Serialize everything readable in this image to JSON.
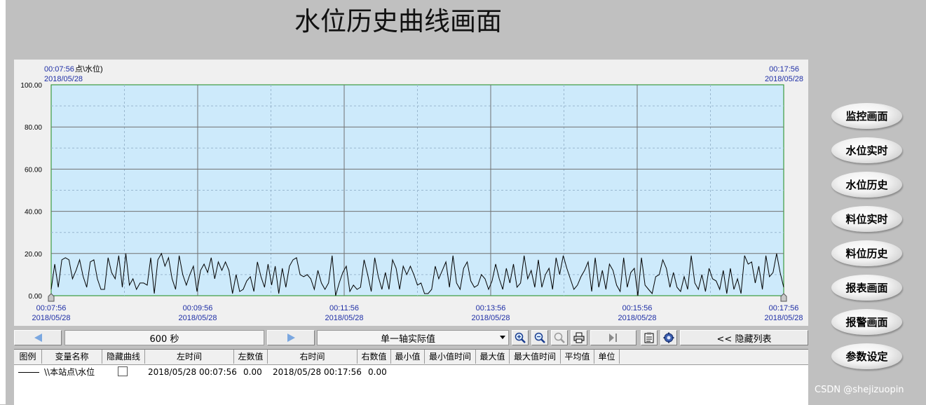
{
  "page": {
    "title": "水位历史曲线画面"
  },
  "chart_header": {
    "left_time": "00:07:56",
    "left_label": "点\\水位)",
    "left_date": "2018/05/28",
    "right_time": "00:17:56",
    "right_date": "2018/05/28"
  },
  "chart_data": {
    "type": "line",
    "ylim": [
      0,
      100
    ],
    "y_ticks": [
      "100.00",
      "80.00",
      "60.00",
      "40.00",
      "20.00",
      "0.00"
    ],
    "x_ticks": [
      {
        "time": "00:07:56",
        "date": "2018/05/28"
      },
      {
        "time": "00:09:56",
        "date": "2018/05/28"
      },
      {
        "time": "00:11:56",
        "date": "2018/05/28"
      },
      {
        "time": "00:13:56",
        "date": "2018/05/28"
      },
      {
        "time": "00:15:56",
        "date": "2018/05/28"
      },
      {
        "time": "00:17:56",
        "date": "2018/05/28"
      }
    ],
    "x_range_seconds": 600,
    "grid": true,
    "series": [
      {
        "values": [
          3,
          15,
          4,
          17,
          18,
          17,
          8,
          12,
          17,
          9,
          4,
          16,
          17,
          8,
          3,
          3,
          18,
          11,
          8,
          19,
          4,
          20,
          5,
          8,
          3,
          6,
          6,
          5,
          18,
          1,
          17,
          20,
          14,
          18,
          8,
          3,
          19,
          10,
          5,
          10,
          14,
          2,
          12,
          15,
          11,
          18,
          8,
          16,
          12,
          16,
          12,
          1,
          10,
          2,
          3,
          7,
          9,
          2,
          16,
          9,
          4,
          15,
          5,
          14,
          1,
          13,
          4,
          14,
          17,
          18,
          10,
          9,
          10,
          8,
          3,
          12,
          6,
          3,
          6,
          19,
          0,
          6,
          11,
          14,
          2,
          5,
          3,
          4,
          17,
          10,
          2,
          18,
          9,
          3,
          11,
          3,
          17,
          13,
          3,
          14,
          10,
          14,
          10,
          5,
          6,
          1,
          1,
          3,
          14,
          8,
          12,
          16,
          4,
          19,
          6,
          3,
          13,
          16,
          7,
          4,
          5,
          10,
          8,
          3,
          7,
          15,
          8,
          3,
          13,
          6,
          15,
          4,
          6,
          19,
          8,
          12,
          4,
          17,
          4,
          10,
          13,
          3,
          18,
          10,
          19,
          13,
          8,
          3,
          5,
          9,
          12,
          16,
          2,
          18,
          4,
          12,
          3,
          15,
          12,
          5,
          2,
          18,
          4,
          11,
          13,
          0,
          18,
          5,
          3,
          1,
          9,
          10,
          17,
          13,
          4,
          11,
          4,
          2,
          9,
          3,
          19,
          6,
          3,
          10,
          2,
          13,
          8,
          7,
          3,
          12,
          1,
          13,
          3,
          8,
          1,
          19,
          15,
          16,
          6,
          14,
          3,
          19,
          9,
          11,
          20,
          11,
          4
        ],
        "color": "#000000"
      }
    ]
  },
  "toolbar": {
    "duration": "600 秒",
    "axis_mode": "单一轴实际值",
    "hide_list": "<< 隐藏列表"
  },
  "list": {
    "headers": [
      "图例",
      "变量名称",
      "隐藏曲线",
      "左时间",
      "左数值",
      "右时间",
      "右数值",
      "最小值",
      "最小值时间",
      "最大值",
      "最大值时间",
      "平均值",
      "单位"
    ],
    "rows": [
      {
        "name": "\\\\本站点\\水位",
        "left_time": "2018/05/28 00:07:56",
        "left_value": "0.00",
        "right_time": "2018/05/28 00:17:56",
        "right_value": "0.00"
      }
    ]
  },
  "nav": {
    "buttons": [
      "监控画面",
      "水位实时",
      "水位历史",
      "料位实时",
      "料位历史",
      "报表画面",
      "报警画面",
      "参数设定"
    ]
  },
  "watermark": "CSDN @shejizuopin"
}
